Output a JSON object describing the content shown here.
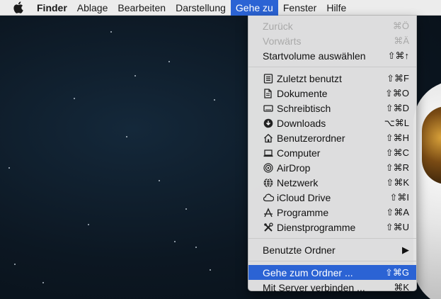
{
  "menubar": {
    "apple_icon": "apple-icon",
    "items": [
      "Finder",
      "Ablage",
      "Bearbeiten",
      "Darstellung",
      "Gehe zu",
      "Fenster",
      "Hilfe"
    ]
  },
  "menu": {
    "title": "Gehe zu",
    "items": [
      {
        "label": "Zurück",
        "shortcut": "⌘Ö",
        "disabled": true
      },
      {
        "label": "Vorwärts",
        "shortcut": "⌘Ä",
        "disabled": true
      },
      {
        "label": "Startvolume auswählen",
        "shortcut": "⇧⌘↑"
      },
      {
        "label": "Zuletzt benutzt",
        "shortcut": "⇧⌘F",
        "icon": "recents-icon"
      },
      {
        "label": "Dokumente",
        "shortcut": "⇧⌘O",
        "icon": "documents-icon"
      },
      {
        "label": "Schreibtisch",
        "shortcut": "⇧⌘D",
        "icon": "desktop-icon"
      },
      {
        "label": "Downloads",
        "shortcut": "⌥⌘L",
        "icon": "downloads-icon"
      },
      {
        "label": "Benutzerordner",
        "shortcut": "⇧⌘H",
        "icon": "home-icon"
      },
      {
        "label": "Computer",
        "shortcut": "⇧⌘C",
        "icon": "computer-icon"
      },
      {
        "label": "AirDrop",
        "shortcut": "⇧⌘R",
        "icon": "airdrop-icon"
      },
      {
        "label": "Netzwerk",
        "shortcut": "⇧⌘K",
        "icon": "network-icon"
      },
      {
        "label": "iCloud Drive",
        "shortcut": "⇧⌘I",
        "icon": "icloud-icon"
      },
      {
        "label": "Programme",
        "shortcut": "⇧⌘A",
        "icon": "applications-icon"
      },
      {
        "label": "Dienstprogramme",
        "shortcut": "⇧⌘U",
        "icon": "utilities-icon"
      },
      {
        "label": "Benutzte Ordner",
        "shortcut": "▶"
      },
      {
        "label": "Gehe zum Ordner ...",
        "shortcut": "⇧⌘G",
        "highlighted": true
      },
      {
        "label": "Mit Server verbinden ...",
        "shortcut": "⌘K"
      }
    ]
  },
  "colors": {
    "highlight": "#2b63d4",
    "menubar_bg": "#ececec",
    "menu_bg": "#e4e4e4"
  }
}
